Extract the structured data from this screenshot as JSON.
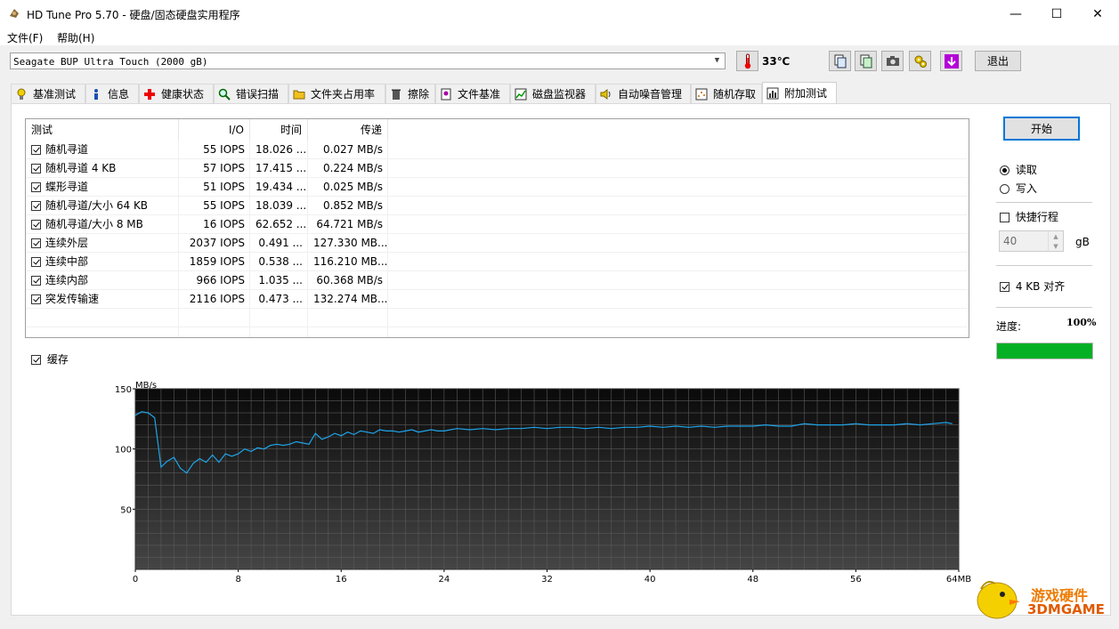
{
  "window": {
    "title": "HD Tune Pro 5.70 - 硬盘/固态硬盘实用程序",
    "minimize": "—",
    "maximize": "☐",
    "close": "✕"
  },
  "menu": [
    "文件(F)",
    "帮助(H)"
  ],
  "toolbar": {
    "drive": "Seagate BUP Ultra Touch (2000 gB)",
    "temperature": "33℃",
    "exit_label": "退出"
  },
  "tabs": [
    "基准测试",
    "信息",
    "健康状态",
    "错误扫描",
    "文件夹占用率",
    "擦除",
    "文件基准",
    "磁盘监视器",
    "自动噪音管理",
    "随机存取",
    "附加测试"
  ],
  "active_tab": "附加测试",
  "table": {
    "columns": [
      "测试",
      "I/O",
      "时间",
      "传递"
    ],
    "rows": [
      {
        "name": "随机寻道",
        "io": "55 IOPS",
        "time": "18.026 ...",
        "transfer": "0.027 MB/s"
      },
      {
        "name": "随机寻道 4 KB",
        "io": "57 IOPS",
        "time": "17.415 ...",
        "transfer": "0.224 MB/s"
      },
      {
        "name": "蝶形寻道",
        "io": "51 IOPS",
        "time": "19.434 ...",
        "transfer": "0.025 MB/s"
      },
      {
        "name": "随机寻道/大小 64 KB",
        "io": "55 IOPS",
        "time": "18.039 ...",
        "transfer": "0.852 MB/s"
      },
      {
        "name": "随机寻道/大小 8 MB",
        "io": "16 IOPS",
        "time": "62.652 ...",
        "transfer": "64.721 MB/s"
      },
      {
        "name": "连续外层",
        "io": "2037 IOPS",
        "time": "0.491 ...",
        "transfer": "127.330 MB..."
      },
      {
        "name": "连续中部",
        "io": "1859 IOPS",
        "time": "0.538 ...",
        "transfer": "116.210 MB..."
      },
      {
        "name": "连续内部",
        "io": "966 IOPS",
        "time": "1.035 ...",
        "transfer": "60.368 MB/s"
      },
      {
        "name": "突发传输速",
        "io": "2116 IOPS",
        "time": "0.473 ...",
        "transfer": "132.274 MB..."
      }
    ]
  },
  "cache_label": "缓存",
  "side": {
    "start_label": "开始",
    "read_label": "读取",
    "write_label": "写入",
    "quick_label": "快捷行程",
    "quick_value": "40",
    "quick_unit": "gB",
    "align_label": "4 KB 对齐",
    "progress_label": "进度:",
    "progress_value": "100%",
    "progress_fraction": 1.0,
    "progress_color": "#06b025"
  },
  "watermark": {
    "line1": "游戏硬件",
    "line2": "3DMGAME"
  },
  "chart_data": {
    "type": "line",
    "ylabel": "MB/s",
    "xunit": "MB",
    "xlim": [
      0,
      64
    ],
    "ylim": [
      0,
      150
    ],
    "yticks": [
      50,
      100,
      150
    ],
    "xticks": [
      0,
      8,
      16,
      24,
      32,
      40,
      48,
      56,
      64
    ],
    "line_color": "#1ea4e9",
    "x": [
      0,
      0.5,
      1,
      1.5,
      2,
      2.5,
      3,
      3.5,
      4,
      4.5,
      5,
      5.5,
      6,
      6.5,
      7,
      7.5,
      8,
      8.5,
      9,
      9.5,
      10,
      10.5,
      11,
      11.5,
      12,
      12.5,
      13,
      13.5,
      14,
      14.5,
      15,
      15.5,
      16,
      16.5,
      17,
      17.5,
      18,
      18.5,
      19,
      19.5,
      20,
      20.5,
      21,
      21.5,
      22,
      22.5,
      23,
      23.5,
      24,
      25,
      26,
      27,
      28,
      29,
      30,
      31,
      32,
      33,
      34,
      35,
      36,
      37,
      38,
      39,
      40,
      41,
      42,
      43,
      44,
      45,
      46,
      47,
      48,
      49,
      50,
      51,
      52,
      53,
      54,
      55,
      56,
      57,
      58,
      59,
      60,
      61,
      62,
      63,
      63.5
    ],
    "values": [
      128,
      131,
      130,
      126,
      85,
      90,
      93,
      84,
      80,
      88,
      92,
      89,
      95,
      89,
      96,
      94,
      96,
      100,
      98,
      101,
      100,
      103,
      104,
      103,
      104,
      106,
      105,
      104,
      113,
      108,
      110,
      113,
      111,
      114,
      112,
      115,
      114,
      113,
      116,
      115,
      115,
      114,
      115,
      116,
      114,
      115,
      116,
      115,
      115,
      117,
      116,
      117,
      116,
      117,
      117,
      118,
      117,
      118,
      118,
      117,
      118,
      117,
      118,
      118,
      119,
      118,
      119,
      118,
      119,
      118,
      119,
      119,
      119,
      120,
      119,
      119,
      121,
      120,
      120,
      120,
      121,
      120,
      120,
      120,
      121,
      120,
      121,
      122,
      121
    ]
  }
}
